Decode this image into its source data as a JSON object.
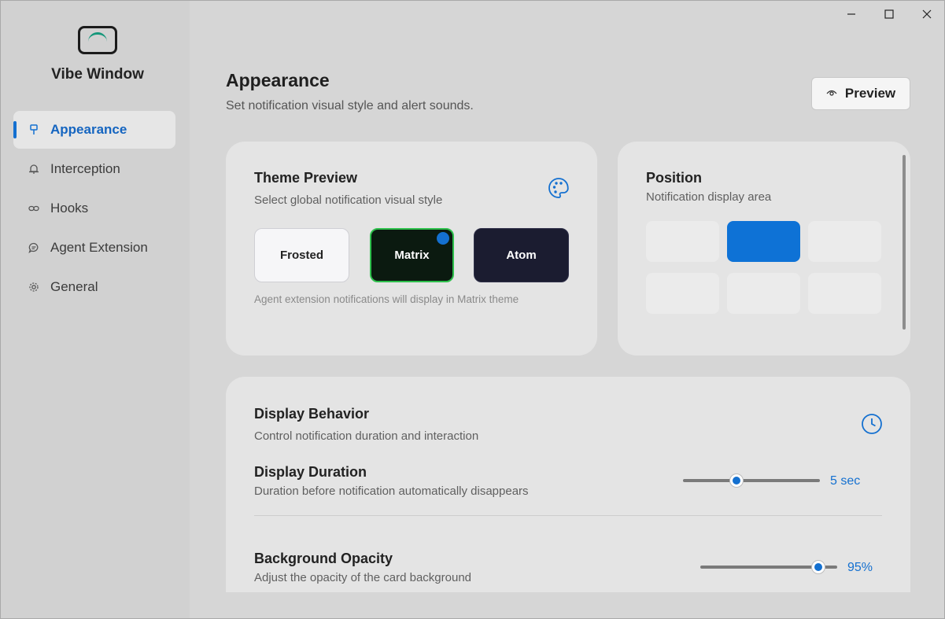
{
  "app": {
    "name": "Vibe Window"
  },
  "window_controls": {
    "minimize": "—",
    "maximize": "☐",
    "close": "✕"
  },
  "sidebar": {
    "items": [
      {
        "label": "Appearance",
        "icon": "brush-icon",
        "active": true
      },
      {
        "label": "Interception",
        "icon": "bell-icon",
        "active": false
      },
      {
        "label": "Hooks",
        "icon": "link-icon",
        "active": false
      },
      {
        "label": "Agent Extension",
        "icon": "chat-icon",
        "active": false
      },
      {
        "label": "General",
        "icon": "gear-icon",
        "active": false
      }
    ]
  },
  "header": {
    "title": "Appearance",
    "subtitle": "Set notification visual style and alert sounds.",
    "preview_label": "Preview"
  },
  "theme_card": {
    "title": "Theme Preview",
    "subtitle": "Select global notification visual style",
    "options": [
      "Frosted",
      "Matrix",
      "Atom"
    ],
    "selected": "Matrix",
    "note": "Agent extension notifications will display in Matrix theme"
  },
  "position_card": {
    "title": "Position",
    "subtitle": "Notification display area",
    "selected_cell": "top-center"
  },
  "behavior_card": {
    "title": "Display Behavior",
    "subtitle": "Control notification duration and interaction",
    "duration": {
      "title": "Display Duration",
      "description": "Duration before notification automatically disappears",
      "value_label": "5 sec",
      "fraction": 0.39
    },
    "opacity": {
      "title": "Background Opacity",
      "description": "Adjust the opacity of the card background",
      "value_label": "95%",
      "fraction": 0.86
    }
  },
  "colors": {
    "accent": "#1470d0",
    "matrix_border": "#2ec04c",
    "logo_accent": "#14977a"
  }
}
